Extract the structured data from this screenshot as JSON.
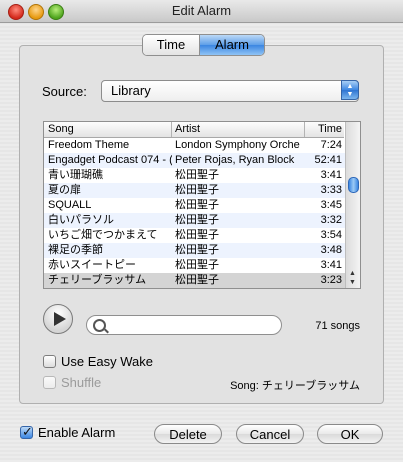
{
  "window": {
    "title": "Edit Alarm"
  },
  "tabs": [
    {
      "label": "Time"
    },
    {
      "label": "Alarm"
    }
  ],
  "source": {
    "label": "Source:",
    "value": "Library"
  },
  "table": {
    "columns": {
      "song": "Song",
      "artist": "Artist",
      "time": "Time"
    },
    "rows": [
      {
        "song": "Freedom Theme",
        "artist": "London Symphony Orche",
        "time": "7:24"
      },
      {
        "song": "Engadget Podcast 074 - (",
        "artist": "Peter Rojas, Ryan Block",
        "time": "52:41"
      },
      {
        "song": "青い珊瑚礁",
        "artist": "松田聖子",
        "time": "3:41"
      },
      {
        "song": "夏の扉",
        "artist": "松田聖子",
        "time": "3:33"
      },
      {
        "song": "SQUALL",
        "artist": "松田聖子",
        "time": "3:45"
      },
      {
        "song": "白いパラソル",
        "artist": "松田聖子",
        "time": "3:32"
      },
      {
        "song": "いちご畑でつかまえて",
        "artist": "松田聖子",
        "time": "3:54"
      },
      {
        "song": "裸足の季節",
        "artist": "松田聖子",
        "time": "3:48"
      },
      {
        "song": "赤いスイートピー",
        "artist": "松田聖子",
        "time": "3:41"
      },
      {
        "song": "チェリーブラッサム",
        "artist": "松田聖子",
        "time": "3:23"
      }
    ],
    "selected_index": 9
  },
  "search": {
    "value": "",
    "placeholder": ""
  },
  "song_count": "71 songs",
  "options": {
    "easy_wake": {
      "label": "Use Easy Wake",
      "checked": false
    },
    "shuffle": {
      "label": "Shuffle",
      "checked": false,
      "disabled": true
    }
  },
  "current_song": "Song: チェリーブラッサム",
  "footer": {
    "enable_alarm": {
      "label": "Enable Alarm",
      "checked": true
    },
    "delete_label": "Delete",
    "cancel_label": "Cancel",
    "ok_label": "OK"
  }
}
